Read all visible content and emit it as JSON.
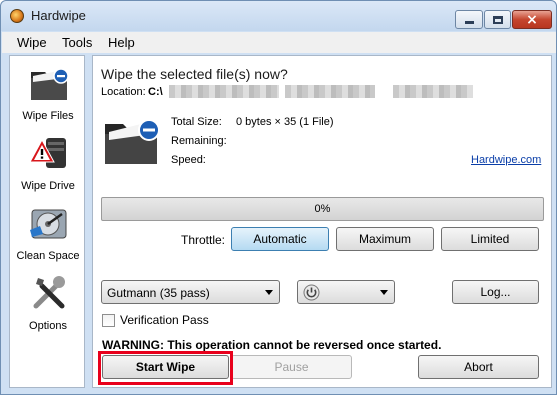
{
  "window": {
    "title": "Hardwipe",
    "controls": {
      "minimize": "minimize",
      "maximize": "maximize",
      "close": "×"
    }
  },
  "menu": [
    "Wipe",
    "Tools",
    "Help"
  ],
  "sidebar": {
    "items": [
      {
        "label": "Wipe Files",
        "icon": "folder-wipe-icon"
      },
      {
        "label": "Wipe Drive",
        "icon": "drive-warning-icon"
      },
      {
        "label": "Clean Space",
        "icon": "hard-disk-icon"
      },
      {
        "label": "Options",
        "icon": "tools-icon"
      }
    ]
  },
  "main": {
    "heading": "Wipe the selected file(s) now?",
    "location_label": "Location:",
    "location_value": "C:\\",
    "stats": {
      "total_size_label": "Total Size:",
      "total_size_value": "0 bytes  ×  35 (1 File)",
      "remaining_label": "Remaining:",
      "speed_label": "Speed:"
    },
    "link": "Hardwipe.com",
    "progress": {
      "value_percent": 0,
      "text": "0%"
    },
    "throttle": {
      "label": "Throttle:",
      "options": [
        "Automatic",
        "Maximum",
        "Limited"
      ],
      "selected": "Automatic"
    },
    "method_select": "Gutmann (35 pass)",
    "power_select_icon": "power-icon",
    "log_button": "Log...",
    "verification_label": "Verification Pass",
    "verification_checked": false,
    "warning": "WARNING: This operation cannot be reversed once started.",
    "start_button": "Start Wipe",
    "pause_button": "Pause",
    "abort_button": "Abort"
  },
  "colors": {
    "highlight": "#e8001c",
    "link": "#0a3ea8",
    "active_button": "#b5daf2",
    "progress_fill": "#36b33a"
  }
}
